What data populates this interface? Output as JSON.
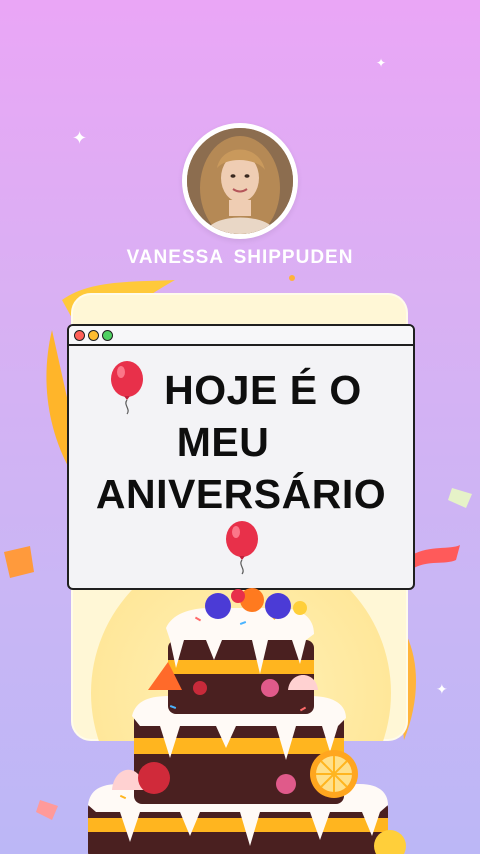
{
  "profile": {
    "name": "VANESSA  SHIPPUDEN"
  },
  "message": {
    "line1": "HOJE  É  O",
    "line2": "MEU",
    "line3": "ANIVERSÁRIO"
  },
  "window_controls": [
    "close",
    "minimize",
    "maximize"
  ],
  "icons": {
    "balloon": "red-balloon-icon",
    "sparkle": "sparkle-icon"
  },
  "colors": {
    "background_top": "#eaa6f6",
    "background_bottom": "#bcb7f6",
    "card": "#fff7d6",
    "balloon": "#e8304a",
    "text": "#0e0e0e"
  }
}
